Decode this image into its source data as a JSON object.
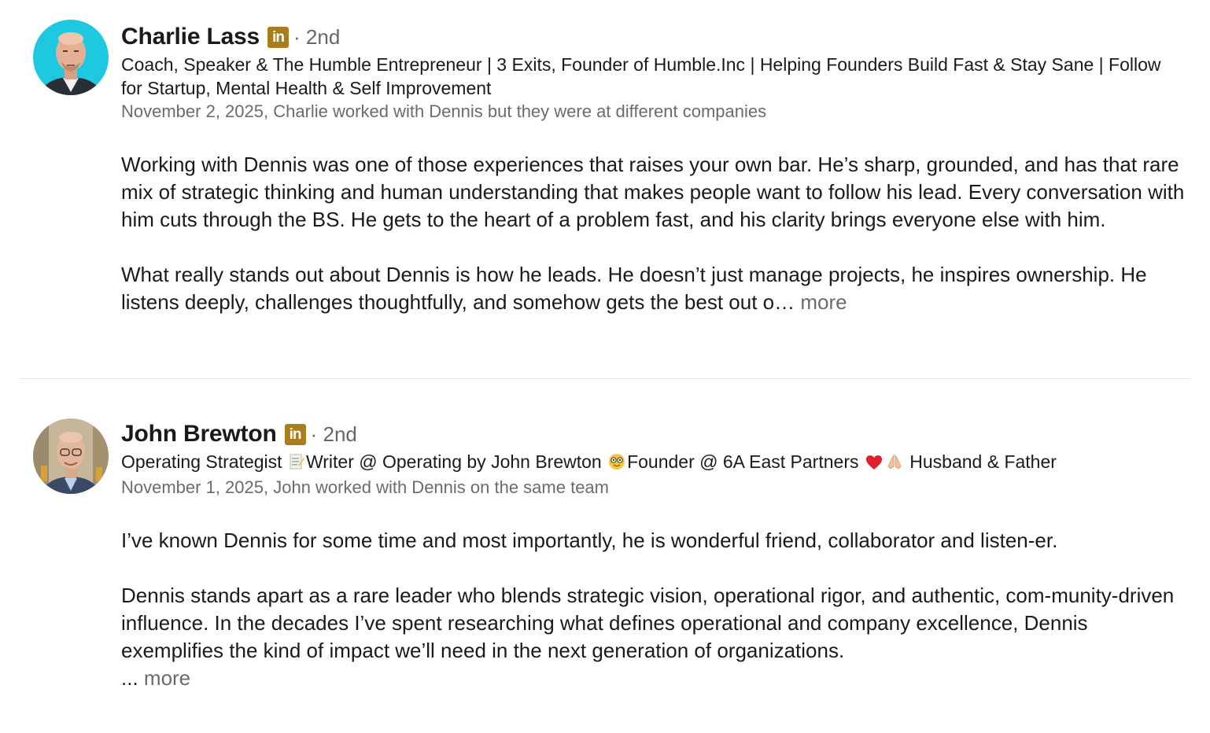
{
  "recommendations": [
    {
      "name": "Charlie Lass",
      "linkedin_badge": "in",
      "degree": "· 2nd",
      "headline": "Coach, Speaker & The Humble Entrepreneur | 3 Exits, Founder of Humble.Inc | Helping Founders Build Fast & Stay Sane | Follow for Startup, Mental Health & Self Improvement",
      "meta": "November 2, 2025, Charlie worked with Dennis but they were at different companies",
      "paragraphs": [
        "Working with Dennis was one of those experiences that raises your own bar. He’s sharp, grounded, and has that rare mix of strategic thinking and human understanding that makes people want to follow his lead. Every conversation with him cuts through the BS. He gets to the heart of a problem fast, and his clarity brings everyone else with him.",
        "What really stands out about Dennis is how he leads. He doesn’t just manage projects, he inspires ownership. He listens deeply, challenges thoughtfully, and somehow gets the best out o… "
      ],
      "more_label": "more",
      "avatar_color": "#1ec8e0"
    },
    {
      "name": "John Brewton",
      "linkedin_badge": "in",
      "degree": "· 2nd",
      "headline_parts": {
        "a": "Operating Strategist ",
        "b": "Writer @ Operating by John Brewton ",
        "c": "Founder @ 6A East Partners ",
        "d": " Husband & Father"
      },
      "meta": "November 1, 2025, John worked with Dennis on the same team",
      "paragraphs": [
        "I’ve known Dennis for some time and most importantly, he is wonderful friend, collaborator and listen-er.",
        "Dennis stands apart as a rare leader who blends strategic vision, operational rigor, and authentic, com-munity-driven influence. In the decades I’ve spent researching what defines operational and company excellence, Dennis exemplifies the kind of impact we’ll need in the next generation of organizations."
      ],
      "ellipsis": "... ",
      "more_label": "more",
      "avatar_color": "#b9a88c"
    }
  ],
  "colors": {
    "badge": "#a87d1c",
    "muted": "#6b6b6b",
    "divider": "#e3e3e3"
  },
  "icons": [
    "memo-icon",
    "nerd-face-icon",
    "red-heart-icon",
    "folded-hands-icon"
  ]
}
